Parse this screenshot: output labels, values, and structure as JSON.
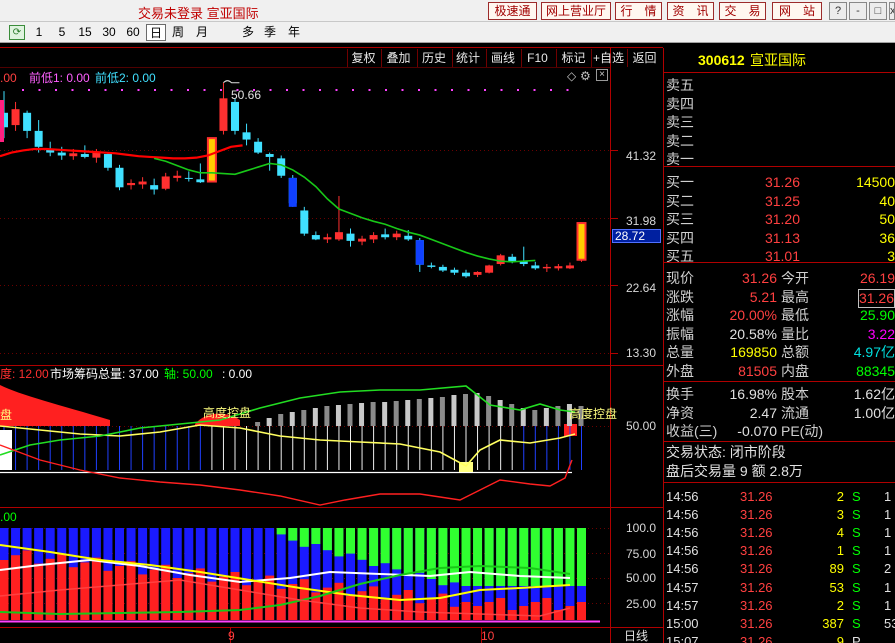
{
  "titlebar": {
    "title": "交易未登录  宣亚国际",
    "buttons": [
      "极速通",
      "网上营业厅",
      "行　情",
      "资　讯",
      "交　易",
      "网　站"
    ],
    "window_controls": [
      "?",
      "-",
      "□",
      "x"
    ]
  },
  "periodbar": {
    "items": [
      "1",
      "5",
      "15",
      "30",
      "60",
      "日",
      "周",
      "月",
      "多",
      "季",
      "年"
    ],
    "active": "日"
  },
  "chart_toolbar": {
    "buttons": [
      "复权",
      "叠加",
      "历史",
      "统计",
      "画线",
      "F10",
      "标记",
      "+自选",
      "返回"
    ]
  },
  "main_chart": {
    "legend": {
      "prefix": ".00",
      "item1": "前低1: 0.00",
      "item2": "前低2: 0.00"
    },
    "price_labels": [
      "41.32",
      "31.98",
      "22.64",
      "13.30"
    ],
    "current_price_tag": "28.72",
    "high_annotation": "50.66"
  },
  "indicator1": {
    "legend": {
      "prefix": "度: 12.00",
      "item1": "市场筹码总量: 37.00",
      "item2": "轴: 50.00",
      "item3": ": 0.00"
    },
    "label_left": "盘",
    "label_mid": "高度控盘",
    "label_right": "高度控盘",
    "axis_label": "50.00"
  },
  "indicator2": {
    "legend": ".00",
    "axis_labels": [
      "100.0",
      "75.00",
      "50.00",
      "25.00"
    ]
  },
  "date_axis": {
    "labels": [
      "9",
      "10"
    ],
    "period_label": "日线"
  },
  "colors": {
    "up": "#ff3030",
    "down": "#40e0ff",
    "ma": "#ff0000",
    "ma2": "#18c818",
    "accent": "#b00000"
  },
  "quote": {
    "code": "300612",
    "name": "宣亚国际",
    "asks": [
      {
        "label": "卖五",
        "price": "",
        "vol": ""
      },
      {
        "label": "卖四",
        "price": "",
        "vol": ""
      },
      {
        "label": "卖三",
        "price": "",
        "vol": ""
      },
      {
        "label": "卖二",
        "price": "",
        "vol": ""
      },
      {
        "label": "卖一",
        "price": "",
        "vol": ""
      }
    ],
    "bids": [
      {
        "label": "买一",
        "price": "31.26",
        "vol": "14500"
      },
      {
        "label": "买二",
        "price": "31.25",
        "vol": "40"
      },
      {
        "label": "买三",
        "price": "31.20",
        "vol": "50"
      },
      {
        "label": "买四",
        "price": "31.13",
        "vol": "36"
      },
      {
        "label": "买五",
        "price": "31.01",
        "vol": "3"
      }
    ],
    "stats": [
      {
        "l1": "现价",
        "v1": "31.26",
        "c1": "red",
        "l2": "今开",
        "v2": "26.19",
        "c2": "red"
      },
      {
        "l1": "涨跌",
        "v1": "5.21",
        "c1": "red",
        "l2": "最高",
        "v2": "31.26",
        "c2": "red"
      },
      {
        "l1": "涨幅",
        "v1": "20.00%",
        "c1": "red",
        "l2": "最低",
        "v2": "25.90",
        "c2": "grn"
      },
      {
        "l1": "振幅",
        "v1": "20.58%",
        "c1": "wht",
        "l2": "量比",
        "v2": "3.22",
        "c2": "mag"
      },
      {
        "l1": "总量",
        "v1": "169850",
        "c1": "yel",
        "l2": "总额",
        "v2": "4.97亿",
        "c2": "cyan"
      },
      {
        "l1": "外盘",
        "v1": "81505",
        "c1": "red",
        "l2": "内盘",
        "v2": "88345",
        "c2": "grn"
      }
    ],
    "stats2": [
      {
        "l1": "换手",
        "v1": "16.98%",
        "l2": "股本",
        "v2": "1.62亿"
      },
      {
        "l1": "净资",
        "v1": "2.47",
        "l2": "流通",
        "v2": "1.00亿"
      },
      {
        "l1": "收益(三)",
        "v1": "-0.070",
        "l2": "PE(动)",
        "v2": ""
      }
    ],
    "status": "交易状态: 闭市阶段",
    "after_hours": "盘后交易量 9 额 2.8万",
    "ticks": [
      {
        "time": "14:56",
        "price": "31.26",
        "vol": "2",
        "side": "S",
        "n": "1"
      },
      {
        "time": "14:56",
        "price": "31.26",
        "vol": "3",
        "side": "S",
        "n": "1"
      },
      {
        "time": "14:56",
        "price": "31.26",
        "vol": "4",
        "side": "S",
        "n": "1"
      },
      {
        "time": "14:56",
        "price": "31.26",
        "vol": "1",
        "side": "S",
        "n": "1"
      },
      {
        "time": "14:56",
        "price": "31.26",
        "vol": "89",
        "side": "S",
        "n": "2"
      },
      {
        "time": "14:57",
        "price": "31.26",
        "vol": "53",
        "side": "S",
        "n": "1"
      },
      {
        "time": "14:57",
        "price": "31.26",
        "vol": "2",
        "side": "S",
        "n": "1"
      },
      {
        "time": "15:00",
        "price": "31.26",
        "vol": "387",
        "side": "S",
        "n": "53"
      },
      {
        "time": "15:07",
        "price": "31.26",
        "vol": "9",
        "side": "P",
        "n": ""
      }
    ]
  },
  "chart_data": {
    "type": "candlestick",
    "ylim": [
      13.3,
      52.0
    ],
    "candles": [
      [
        46.5,
        49.5,
        43.0,
        44.5
      ],
      [
        44.8,
        48.0,
        44.0,
        47.0
      ],
      [
        46.5,
        46.8,
        43.0,
        44.0
      ],
      [
        44.0,
        45.5,
        41.0,
        41.8
      ],
      [
        41.5,
        42.5,
        40.5,
        41.0
      ],
      [
        41.0,
        41.8,
        40.0,
        40.6
      ],
      [
        40.5,
        41.5,
        40.0,
        40.9
      ],
      [
        40.8,
        42.0,
        40.2,
        40.4
      ],
      [
        40.3,
        41.5,
        39.6,
        41.0
      ],
      [
        40.8,
        40.9,
        38.5,
        38.9
      ],
      [
        38.9,
        39.3,
        35.8,
        36.2
      ],
      [
        36.5,
        37.3,
        35.9,
        36.8
      ],
      [
        36.6,
        37.6,
        36.0,
        37.0
      ],
      [
        36.5,
        37.4,
        35.2,
        35.9
      ],
      [
        36.0,
        38.2,
        35.8,
        37.7
      ],
      [
        37.5,
        38.5,
        37.0,
        37.8
      ],
      [
        37.5,
        38.4,
        37.0,
        37.4
      ],
      [
        37.3,
        39.5,
        36.8,
        36.9
      ],
      [
        37.0,
        43.0,
        36.9,
        43.0
      ],
      [
        44.0,
        50.66,
        43.5,
        48.5
      ],
      [
        48.0,
        48.5,
        43.5,
        44.0
      ],
      [
        43.8,
        45.0,
        42.0,
        42.8
      ],
      [
        42.5,
        43.0,
        40.8,
        41.0
      ],
      [
        40.8,
        41.0,
        38.5,
        40.4
      ],
      [
        40.2,
        40.6,
        37.5,
        37.8
      ],
      [
        37.5,
        37.9,
        33.5,
        34.0
      ],
      [
        33.0,
        33.5,
        29.5,
        29.8
      ],
      [
        29.6,
        30.1,
        28.9,
        29.0
      ],
      [
        29.0,
        29.8,
        28.5,
        29.3
      ],
      [
        29.0,
        35.0,
        28.8,
        30.0
      ],
      [
        29.8,
        30.5,
        28.0,
        28.8
      ],
      [
        28.7,
        29.5,
        28.2,
        29.1
      ],
      [
        29.0,
        30.0,
        28.5,
        29.6
      ],
      [
        29.7,
        30.5,
        29.0,
        29.3
      ],
      [
        29.3,
        30.2,
        28.9,
        29.8
      ],
      [
        29.5,
        30.3,
        28.8,
        29.0
      ],
      [
        28.9,
        29.2,
        24.5,
        25.5
      ],
      [
        25.4,
        25.8,
        25.0,
        25.2
      ],
      [
        25.2,
        25.5,
        24.5,
        24.7
      ],
      [
        24.8,
        25.1,
        24.1,
        24.4
      ],
      [
        24.4,
        24.8,
        23.7,
        23.9
      ],
      [
        24.1,
        24.6,
        23.8,
        24.5
      ],
      [
        24.4,
        25.5,
        24.3,
        25.4
      ],
      [
        25.6,
        27.0,
        25.4,
        26.8
      ],
      [
        26.6,
        27.0,
        25.7,
        26.0
      ],
      [
        26.0,
        28.0,
        25.3,
        25.6
      ],
      [
        25.4,
        25.9,
        24.8,
        25.0
      ],
      [
        25.0,
        25.6,
        24.5,
        25.2
      ],
      [
        25.0,
        25.6,
        24.7,
        25.3
      ],
      [
        25.0,
        25.8,
        24.9,
        25.4
      ],
      [
        26.19,
        31.26,
        25.9,
        31.26
      ]
    ],
    "ma_red": [
      40.5,
      41.0,
      41.3,
      41.5,
      41.5,
      41.4,
      41.3,
      41.2,
      41.1,
      41.0,
      40.9,
      40.7,
      40.5,
      40.4,
      40.3,
      40.2,
      40.2,
      40.3,
      40.6,
      41.2,
      41.8,
      42.0
    ],
    "ma_green": [
      40.2,
      39.8,
      39.2,
      38.6,
      38.2,
      38.2,
      38.1,
      38.0,
      38.5,
      39.0,
      39.5,
      39.3,
      38.6,
      37.6,
      36.3,
      34.6,
      33.2,
      32.6,
      32.0,
      31.5,
      31.1,
      30.5,
      30.0,
      29.6,
      29.0,
      28.4,
      27.8,
      27.2,
      26.7,
      26.3,
      26.0,
      25.9,
      26.0,
      26.1
    ]
  }
}
